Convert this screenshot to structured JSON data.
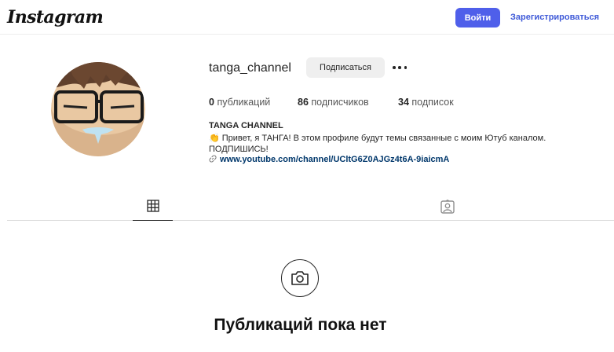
{
  "header": {
    "logo_text": "Instagram",
    "login_label": "Войти",
    "signup_label": "Зарегистрироваться"
  },
  "profile": {
    "username": "tanga_channel",
    "follow_label": "Подписаться",
    "stats": [
      {
        "count": "0",
        "label": "публикаций"
      },
      {
        "count": "86",
        "label": "подписчиков"
      },
      {
        "count": "34",
        "label": "подписок"
      }
    ],
    "full_name": "TANGA CHANNEL",
    "bio_line1": "👏 Привет, я ТАНГА! В этом профиле будут темы связанные с моим Ютуб каналом.",
    "bio_line2": "ПОДПИШИСЬ!",
    "link": "www.youtube.com/channel/UCltG6Z0AJGz4t6A-9iaicmA"
  },
  "tabs": [
    {
      "name": "posts",
      "icon": "grid-icon",
      "active": true
    },
    {
      "name": "tagged",
      "icon": "tagged-icon",
      "active": false
    }
  ],
  "empty_state": {
    "icon": "camera-icon",
    "title": "Публикаций пока нет"
  },
  "colors": {
    "accent": "#4f5fea",
    "link": "#00376b",
    "signup_link": "#3f5ad8"
  }
}
